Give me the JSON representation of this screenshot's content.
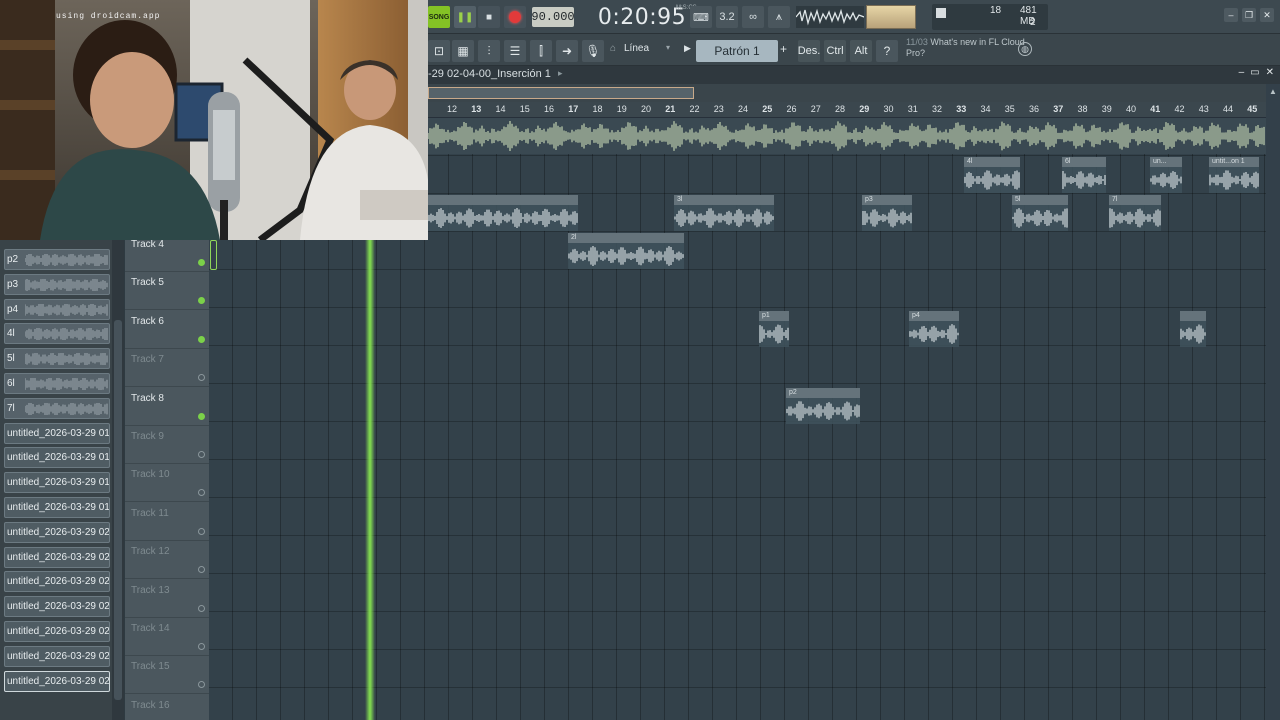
{
  "app": {
    "song_badge": "SONG",
    "tempo": "90.000",
    "time": "0:20:95",
    "time_unit": "M:S:CS",
    "cpu": "18",
    "memory": "481 MB",
    "polyphony": "2",
    "snap": "Línea",
    "pattern": "Patrón 1",
    "btn_des": "Des.",
    "btn_ctrl": "Ctrl",
    "btn_alt": "Alt",
    "news_date": "11/03",
    "news_text": "What's new in FL Cloud Pro?"
  },
  "webcam": {
    "label": "using droidcam.app"
  },
  "playlist": {
    "title": "-29 02-04-00_Inserción 1",
    "ruler": [
      "12",
      "13",
      "14",
      "15",
      "16",
      "17",
      "18",
      "19",
      "20",
      "21",
      "22",
      "23",
      "24",
      "25",
      "26",
      "27",
      "28",
      "29",
      "30",
      "31",
      "32",
      "33",
      "34",
      "35",
      "36",
      "37",
      "38",
      "39",
      "40",
      "41",
      "42",
      "43",
      "44",
      "45"
    ]
  },
  "browser": {
    "items": [
      {
        "label": "p2",
        "type": "clip"
      },
      {
        "label": "p3",
        "type": "clip"
      },
      {
        "label": "p4",
        "type": "clip"
      },
      {
        "label": "4l",
        "type": "clip"
      },
      {
        "label": "5l",
        "type": "clip"
      },
      {
        "label": "6l",
        "type": "clip"
      },
      {
        "label": "7l",
        "type": "clip"
      },
      {
        "label": "untitled_2026-03-29 01-...",
        "type": "audio"
      },
      {
        "label": "untitled_2026-03-29 01-...",
        "type": "audio"
      },
      {
        "label": "untitled_2026-03-29 01-...",
        "type": "audio"
      },
      {
        "label": "untitled_2026-03-29 01-...",
        "type": "audio"
      },
      {
        "label": "untitled_2026-03-29 02-...",
        "type": "audio"
      },
      {
        "label": "untitled_2026-03-29 02-...",
        "type": "audio"
      },
      {
        "label": "untitled_2026-03-29 02-...",
        "type": "audio"
      },
      {
        "label": "untitled_2026-03-29 02-...",
        "type": "audio"
      },
      {
        "label": "untitled_2026-03-29 02-...",
        "type": "audio"
      },
      {
        "label": "untitled_2026-03-29 02-...",
        "type": "audio"
      },
      {
        "label": "untitled_2026-03-29 02-...",
        "type": "audio"
      }
    ]
  },
  "tracks": [
    {
      "name": "Track 4",
      "active": true
    },
    {
      "name": "Track 5",
      "active": true
    },
    {
      "name": "Track 6",
      "active": true
    },
    {
      "name": "Track 7",
      "active": false
    },
    {
      "name": "Track 8",
      "active": true
    },
    {
      "name": "Track 9",
      "active": false
    },
    {
      "name": "Track 10",
      "active": false
    },
    {
      "name": "Track 11",
      "active": false
    },
    {
      "name": "Track 12",
      "active": false
    },
    {
      "name": "Track 13",
      "active": false
    },
    {
      "name": "Track 14",
      "active": false
    },
    {
      "name": "Track 15",
      "active": false
    },
    {
      "name": "Track 16",
      "active": false
    }
  ],
  "clips": [
    {
      "label": "4l"
    },
    {
      "label": "6l"
    },
    {
      "label": "un..."
    },
    {
      "label": "untit...on 1"
    },
    {
      "label": ""
    },
    {
      "label": "3l"
    },
    {
      "label": "p3"
    },
    {
      "label": "5l"
    },
    {
      "label": "7l"
    },
    {
      "label": "2l"
    },
    {
      "label": "p1"
    },
    {
      "label": "p4"
    },
    {
      "label": ""
    },
    {
      "label": "p2"
    }
  ]
}
